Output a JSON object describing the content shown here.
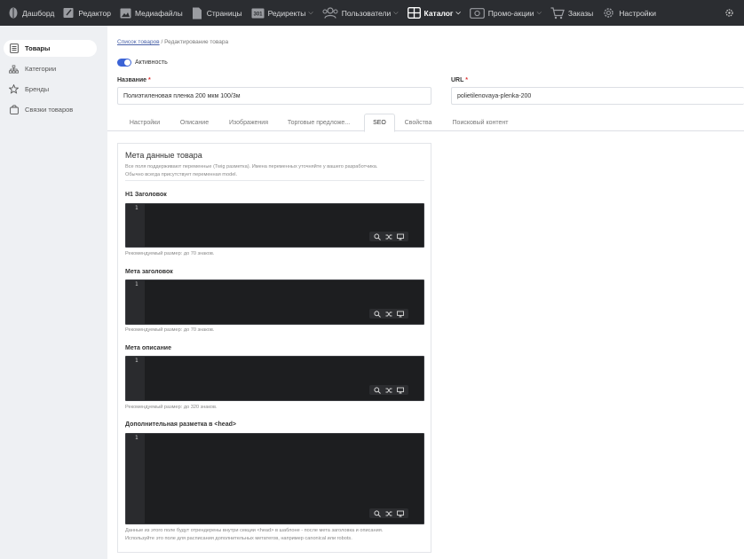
{
  "topnav": {
    "items": [
      {
        "label": "Дашборд",
        "icon": "leaf-icon"
      },
      {
        "label": "Редактор",
        "icon": "edit-icon"
      },
      {
        "label": "Медиафайлы",
        "icon": "image-icon"
      },
      {
        "label": "Страницы",
        "icon": "pages-icon"
      },
      {
        "label": "Редиректы",
        "icon": "redirect-301-icon",
        "badge": "301"
      },
      {
        "label": "Пользователи",
        "icon": "users-icon"
      },
      {
        "label": "Каталог",
        "icon": "catalog-grid-icon"
      },
      {
        "label": "Промо-акции",
        "icon": "promo-icon"
      },
      {
        "label": "Заказы",
        "icon": "cart-icon"
      },
      {
        "label": "Настройки",
        "icon": "gear-icon"
      }
    ],
    "right_icon": "settings-dots-icon"
  },
  "sidebar": {
    "items": [
      {
        "label": "Товары",
        "icon": "list-icon"
      },
      {
        "label": "Категории",
        "icon": "sitemap-icon"
      },
      {
        "label": "Бренды",
        "icon": "star-icon"
      },
      {
        "label": "Связки товаров",
        "icon": "bag-icon"
      }
    ]
  },
  "breadcrumb": {
    "link": "Список товаров",
    "separator": "/",
    "current": "Редактирование товара"
  },
  "form": {
    "active_label": "Активность",
    "name_label": "Название",
    "name_value": "Полиэтиленовая пленка 200 мкм 100/3м",
    "url_label": "URL",
    "url_value": "polietilenovaya-plenka-200",
    "required_mark": "*"
  },
  "tabs": [
    "Настройки",
    "Описание",
    "Изображения",
    "Торговые предложе...",
    "SEO",
    "Свойства",
    "Поисковый контент"
  ],
  "seo": {
    "title": "Мета данные товара",
    "desc_line1": "Все поля поддерживают переменные (Twig разметка). Имена переменных уточняйте у вашего разработчика.",
    "desc_line2": "Обычно всегда присутствует переменная model.",
    "line_number": "1",
    "sections": [
      {
        "label": "H1 Заголовок",
        "hint": "Рекомендуемый размер: до 70 знаков."
      },
      {
        "label": "Мета заголовок",
        "hint": "Рекомендуемый размер: до 70 знаков."
      },
      {
        "label": "Мета описание",
        "hint": "Рекомендуемый размер: до 320 знаков."
      },
      {
        "label": "Дополнительная разметка в <head>",
        "hint": "Данные из этого поле будут отрендерены внутри секции <head> в шаблоне - после мета заголовка и описания.",
        "hint2": "Используйте это поле для расписания дополнительных метатегов, например canonical или robots."
      }
    ]
  },
  "colors": {
    "topbar": "#2b2d31",
    "sidebar": "#eef0f3",
    "accent": "#3b63d6",
    "editor_bg": "#1d1e20"
  }
}
